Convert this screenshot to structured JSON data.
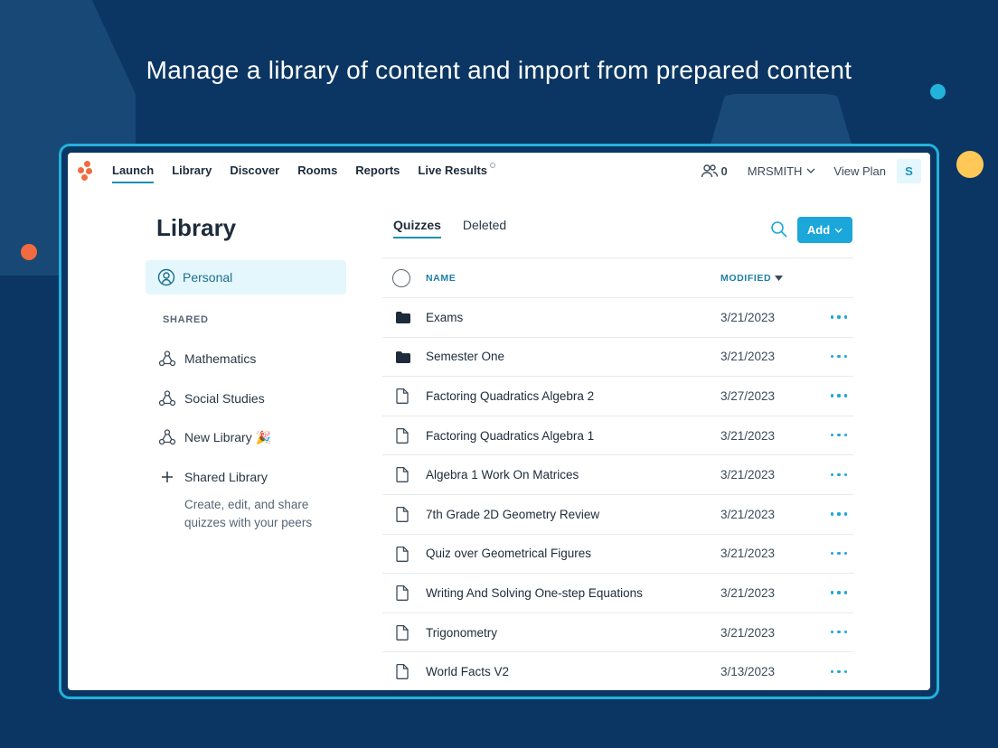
{
  "headline": "Manage a library of content and import from prepared content",
  "nav": {
    "links": [
      "Launch",
      "Library",
      "Discover",
      "Rooms",
      "Reports",
      "Live Results"
    ],
    "active": "Launch",
    "people_count": "0",
    "username": "MRSMITH",
    "view_plan": "View Plan",
    "avatar_initial": "S"
  },
  "sidebar": {
    "title": "Library",
    "personal": "Personal",
    "shared_heading": "SHARED",
    "items": [
      "Mathematics",
      "Social Studies",
      "New Library 🎉"
    ],
    "add_shared": "Shared Library",
    "description": "Create, edit, and share quizzes with your peers"
  },
  "main": {
    "tabs": [
      "Quizzes",
      "Deleted"
    ],
    "active_tab": "Quizzes",
    "add_label": "Add",
    "columns": {
      "name": "NAME",
      "modified": "MODIFIED"
    },
    "rows": [
      {
        "type": "folder",
        "name": "Exams",
        "modified": "3/21/2023"
      },
      {
        "type": "folder",
        "name": "Semester One",
        "modified": "3/21/2023"
      },
      {
        "type": "file",
        "name": "Factoring Quadratics Algebra 2",
        "modified": "3/27/2023"
      },
      {
        "type": "file",
        "name": "Factoring Quadratics Algebra 1",
        "modified": "3/21/2023"
      },
      {
        "type": "file",
        "name": "Algebra 1 Work On Matrices",
        "modified": "3/21/2023"
      },
      {
        "type": "file",
        "name": "7th Grade 2D Geometry Review",
        "modified": "3/21/2023"
      },
      {
        "type": "file",
        "name": "Quiz over Geometrical Figures",
        "modified": "3/21/2023"
      },
      {
        "type": "file",
        "name": "Writing And Solving One-step Equations",
        "modified": "3/21/2023"
      },
      {
        "type": "file",
        "name": "Trigonometry",
        "modified": "3/21/2023"
      },
      {
        "type": "file",
        "name": "World Facts V2",
        "modified": "3/13/2023"
      }
    ]
  },
  "colors": {
    "background": "#0b3663",
    "accent": "#1ba7d9",
    "frame_border": "#24b1dc",
    "logo": "#f26a3f"
  }
}
